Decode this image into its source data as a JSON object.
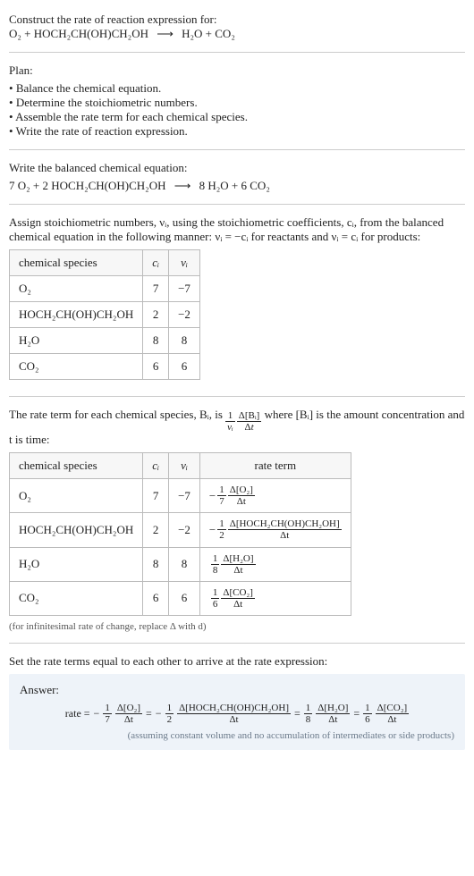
{
  "intro": {
    "prompt": "Construct the rate of reaction expression for:",
    "equation_lhs": "O₂ + HOCH₂CH(OH)CH₂OH",
    "equation_rhs": "H₂O + CO₂",
    "arrow": "⟶"
  },
  "plan": {
    "title": "Plan:",
    "items": [
      "Balance the chemical equation.",
      "Determine the stoichiometric numbers.",
      "Assemble the rate term for each chemical species.",
      "Write the rate of reaction expression."
    ]
  },
  "balanced": {
    "title": "Write the balanced chemical equation:",
    "lhs": "7 O₂ + 2 HOCH₂CH(OH)CH₂OH",
    "rhs": "8 H₂O + 6 CO₂",
    "arrow": "⟶"
  },
  "assign": {
    "text_a": "Assign stoichiometric numbers, νᵢ, using the stoichiometric coefficients, cᵢ, from the balanced chemical equation in the following manner: νᵢ = −cᵢ for reactants and νᵢ = cᵢ for products:",
    "headers": {
      "species": "chemical species",
      "ci": "cᵢ",
      "vi": "νᵢ"
    },
    "rows": [
      {
        "species": "O₂",
        "ci": "7",
        "vi": "−7"
      },
      {
        "species": "HOCH₂CH(OH)CH₂OH",
        "ci": "2",
        "vi": "−2"
      },
      {
        "species": "H₂O",
        "ci": "8",
        "vi": "8"
      },
      {
        "species": "CO₂",
        "ci": "6",
        "vi": "6"
      }
    ]
  },
  "rateterm": {
    "text_a": "The rate term for each chemical species, Bᵢ, is",
    "text_b": "where [Bᵢ] is the amount concentration and t is time:",
    "headers": {
      "species": "chemical species",
      "ci": "cᵢ",
      "vi": "νᵢ",
      "rate": "rate term"
    },
    "rows": [
      {
        "species": "O₂",
        "ci": "7",
        "vi": "−7",
        "sign": "−",
        "coef_num": "1",
        "coef_den": "7",
        "delta": "Δ[O₂]"
      },
      {
        "species": "HOCH₂CH(OH)CH₂OH",
        "ci": "2",
        "vi": "−2",
        "sign": "−",
        "coef_num": "1",
        "coef_den": "2",
        "delta": "Δ[HOCH₂CH(OH)CH₂OH]"
      },
      {
        "species": "H₂O",
        "ci": "8",
        "vi": "8",
        "sign": "",
        "coef_num": "1",
        "coef_den": "8",
        "delta": "Δ[H₂O]"
      },
      {
        "species": "CO₂",
        "ci": "6",
        "vi": "6",
        "sign": "",
        "coef_num": "1",
        "coef_den": "6",
        "delta": "Δ[CO₂]"
      }
    ],
    "note": "(for infinitesimal rate of change, replace Δ with d)",
    "dt": "Δt",
    "generic_num": "Δ[Bᵢ]",
    "generic_coef_num": "1",
    "generic_coef_den": "νᵢ"
  },
  "final": {
    "title": "Set the rate terms equal to each other to arrive at the rate expression:",
    "answer_label": "Answer:",
    "rate_label": "rate =",
    "eq": "=",
    "note": "(assuming constant volume and no accumulation of intermediates or side products)"
  },
  "chart_data": {
    "type": "table",
    "title": "Stoichiometric numbers and rate terms",
    "species": [
      "O₂",
      "HOCH₂CH(OH)CH₂OH",
      "H₂O",
      "CO₂"
    ],
    "c_i": [
      7,
      2,
      8,
      6
    ],
    "nu_i": [
      -7,
      -2,
      8,
      6
    ],
    "rate_terms": [
      "-(1/7) Δ[O₂]/Δt",
      "-(1/2) Δ[HOCH₂CH(OH)CH₂OH]/Δt",
      "(1/8) Δ[H₂O]/Δt",
      "(1/6) Δ[CO₂]/Δt"
    ],
    "balanced_equation": "7 O₂ + 2 HOCH₂CH(OH)CH₂OH ⟶ 8 H₂O + 6 CO₂",
    "rate_expression": "rate = -(1/7) Δ[O₂]/Δt = -(1/2) Δ[HOCH₂CH(OH)CH₂OH]/Δt = (1/8) Δ[H₂O]/Δt = (1/6) Δ[CO₂]/Δt"
  }
}
